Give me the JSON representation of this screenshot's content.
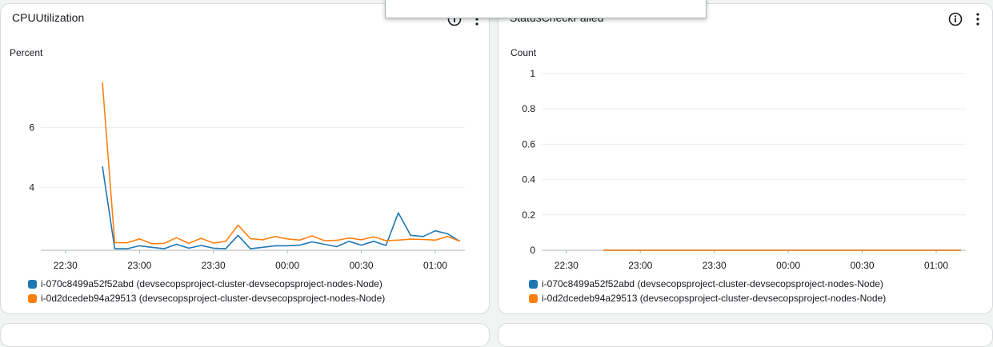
{
  "widgets": [
    {
      "title": "CPUUtilization",
      "unit": "Percent",
      "info_icon": "info-icon",
      "menu_icon": "more-vertical-icon"
    },
    {
      "title": "StatusCheckFailed",
      "unit": "Count",
      "info_icon": "info-icon",
      "menu_icon": "more-vertical-icon"
    }
  ],
  "legend": [
    {
      "label": "i-070c8499a52f52abd (devsecopsproject-cluster-devsecopsproject-nodes-Node)",
      "color": "#1f77b4"
    },
    {
      "label": "i-0d2dcedeb94a29513 (devsecopsproject-cluster-devsecopsproject-nodes-Node)",
      "color": "#ff7f0e"
    }
  ],
  "chart_data": [
    {
      "type": "line",
      "title": "CPUUtilization",
      "ylabel": "Percent",
      "xticks": [
        "22:30",
        "23:00",
        "23:30",
        "00:00",
        "00:30",
        "01:00"
      ],
      "yticks": [
        4,
        6
      ],
      "ylim": [
        1.9,
        7.8
      ],
      "xlim": [
        "22:20",
        "01:12"
      ],
      "grid": true,
      "legend_position": "bottom",
      "x": [
        "22:45",
        "22:50",
        "22:55",
        "23:00",
        "23:05",
        "23:10",
        "23:15",
        "23:20",
        "23:25",
        "23:30",
        "23:35",
        "23:40",
        "23:45",
        "23:50",
        "23:55",
        "00:00",
        "00:05",
        "00:10",
        "00:15",
        "00:20",
        "00:25",
        "00:30",
        "00:35",
        "00:40",
        "00:45",
        "00:50",
        "00:55",
        "01:00",
        "01:05",
        "01:10"
      ],
      "series": [
        {
          "name": "i-070c8499a52f52abd (devsecopsproject-cluster-devsecopsproject-nodes-Node)",
          "color": "#1f77b4",
          "values": [
            4.7,
            1.95,
            1.95,
            2.05,
            2.0,
            1.95,
            2.1,
            1.97,
            2.06,
            1.97,
            1.95,
            2.4,
            1.95,
            2.0,
            2.05,
            2.05,
            2.07,
            2.18,
            2.1,
            2.02,
            2.2,
            2.07,
            2.2,
            2.06,
            3.15,
            2.4,
            2.36,
            2.55,
            2.45,
            2.2
          ]
        },
        {
          "name": "i-0d2dcedeb94a29513 (devsecopsproject-cluster-devsecopsproject-nodes-Node)",
          "color": "#ff7f0e",
          "values": [
            7.5,
            2.15,
            2.15,
            2.28,
            2.12,
            2.13,
            2.32,
            2.13,
            2.3,
            2.14,
            2.2,
            2.74,
            2.29,
            2.25,
            2.36,
            2.28,
            2.24,
            2.38,
            2.22,
            2.23,
            2.31,
            2.25,
            2.35,
            2.22,
            2.24,
            2.27,
            2.26,
            2.24,
            2.36,
            2.2
          ]
        }
      ]
    },
    {
      "type": "line",
      "title": "StatusCheckFailed",
      "ylabel": "Count",
      "xticks": [
        "22:30",
        "23:00",
        "23:30",
        "00:00",
        "00:30",
        "01:00"
      ],
      "yticks": [
        0,
        0.2,
        0.4,
        0.6,
        0.8,
        1
      ],
      "ylim": [
        0,
        1
      ],
      "xlim": [
        "22:20",
        "01:12"
      ],
      "grid": true,
      "legend_position": "bottom",
      "x": [
        "22:45",
        "01:10"
      ],
      "series": [
        {
          "name": "i-070c8499a52f52abd (devsecopsproject-cluster-devsecopsproject-nodes-Node)",
          "color": "#1f77b4",
          "values": [
            0,
            0
          ]
        },
        {
          "name": "i-0d2dcedeb94a29513 (devsecopsproject-cluster-devsecopsproject-nodes-Node)",
          "color": "#ff7f0e",
          "values": [
            0,
            0
          ]
        }
      ]
    }
  ]
}
